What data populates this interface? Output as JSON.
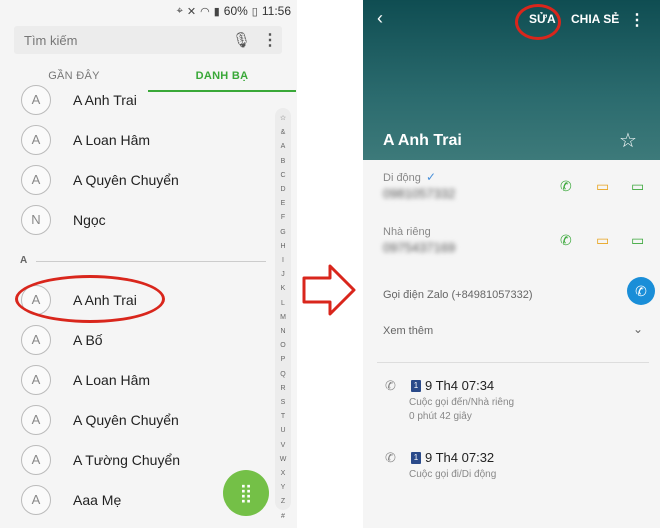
{
  "left": {
    "status": {
      "battery": "60%",
      "time": "11:56"
    },
    "search": {
      "placeholder": "Tìm kiếm"
    },
    "tabs": [
      {
        "label": "GẦN ĐÂY"
      },
      {
        "label": "DANH BẠ"
      }
    ],
    "contacts_top": [
      {
        "initial": "A",
        "name": "A Anh Trai"
      },
      {
        "initial": "A",
        "name": "A Loan Hâm"
      },
      {
        "initial": "A",
        "name": "A Quyên Chuyển"
      },
      {
        "initial": "N",
        "name": "Ngọc"
      }
    ],
    "section_letter": "A",
    "contacts_a": [
      {
        "initial": "A",
        "name": "A Anh Trai"
      },
      {
        "initial": "A",
        "name": "A Bố"
      },
      {
        "initial": "A",
        "name": "A Loan Hâm"
      },
      {
        "initial": "A",
        "name": "A Quyên Chuyển"
      },
      {
        "initial": "A",
        "name": "A Tường Chuyển"
      },
      {
        "initial": "A",
        "name": "Aaa Mẹ"
      }
    ],
    "index_letters": [
      "☆",
      "&",
      "A",
      "B",
      "C",
      "D",
      "E",
      "F",
      "G",
      "H",
      "I",
      "J",
      "K",
      "L",
      "M",
      "N",
      "O",
      "P",
      "Q",
      "R",
      "S",
      "T",
      "U",
      "V",
      "W",
      "X",
      "Y",
      "Z",
      "#"
    ]
  },
  "right": {
    "header": {
      "edit": "SỬA",
      "share": "CHIA SẺ",
      "title": "A Anh Trai"
    },
    "mobile": {
      "label": "Di động",
      "value": "0981057332"
    },
    "home": {
      "label": "Nhà riêng",
      "value": "0975437169"
    },
    "zalo": {
      "label": "Gọi điện Zalo (+84981057332)"
    },
    "more": {
      "label": "Xem thêm"
    },
    "logs": [
      {
        "sim": "1",
        "time": "9 Th4 07:34",
        "desc1": "Cuộc gọi đến/Nhà riêng",
        "desc2": "0 phút 42 giây"
      },
      {
        "sim": "1",
        "time": "9 Th4 07:32",
        "desc1": "Cuộc gọi đi/Di động"
      }
    ]
  },
  "colors": {
    "accent": "#39a838",
    "annotation": "#d9261c",
    "header": "#1f5f63"
  },
  "icons": [
    "search-icon",
    "mic-icon",
    "more-vert-icon",
    "dialpad-icon",
    "back-arrow-icon",
    "star-icon",
    "call-icon",
    "message-icon",
    "video-icon",
    "zalo-phone-icon",
    "chevron-down-icon",
    "call-incoming-icon",
    "call-outgoing-icon",
    "verified-check-icon"
  ]
}
